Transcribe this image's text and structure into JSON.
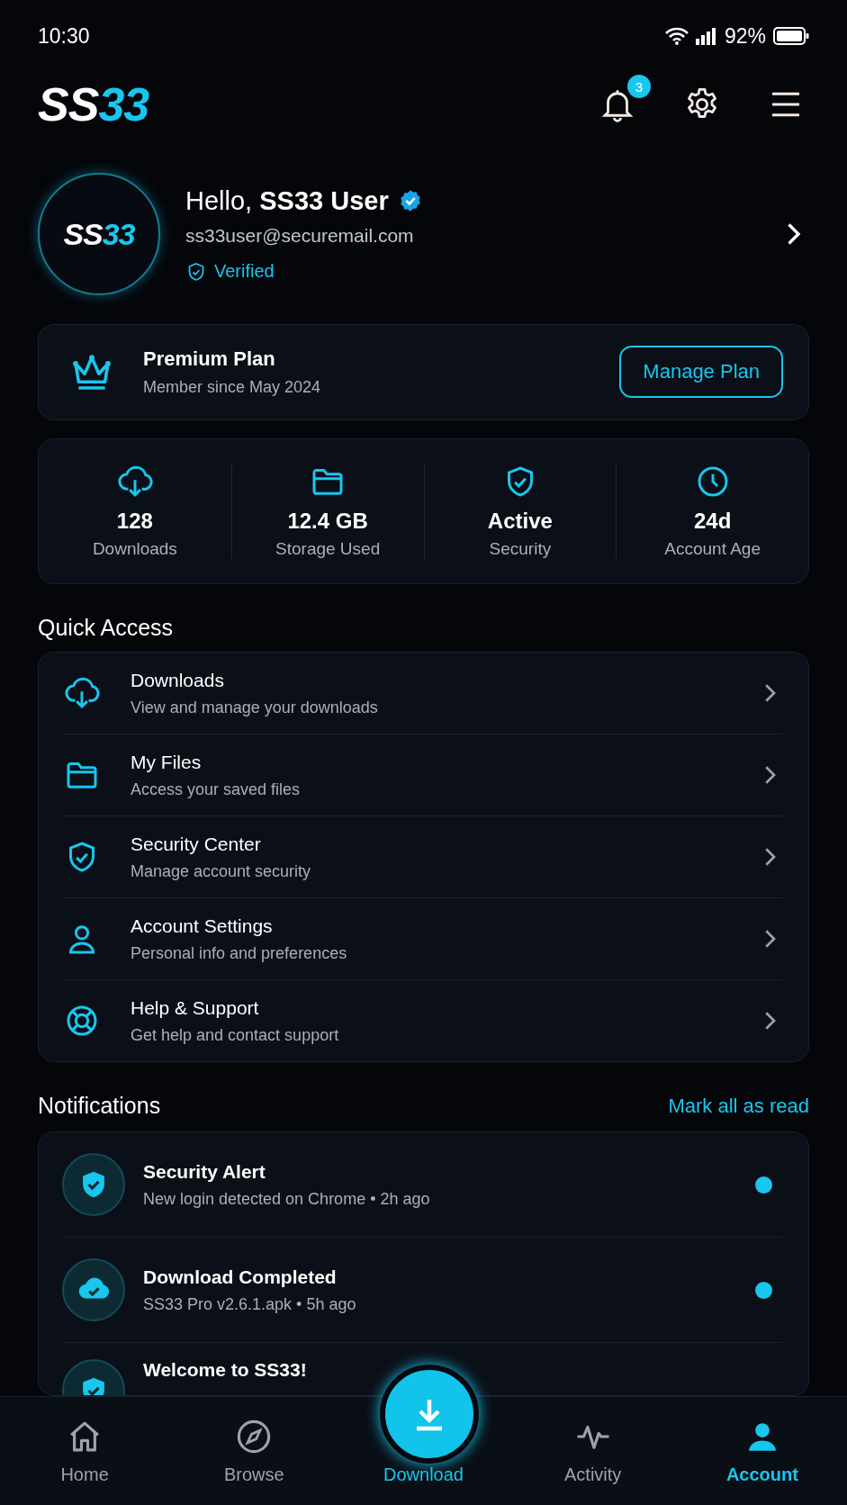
{
  "status_bar": {
    "time": "10:30",
    "battery": "92%"
  },
  "header": {
    "logo": [
      {
        "text": "SS",
        "color": "#ffffff"
      },
      {
        "text": "33",
        "color": "#19c6ee"
      }
    ],
    "notification_count": "3"
  },
  "profile": {
    "avatar_logo": [
      {
        "text": "SS",
        "color": "#ffffff"
      },
      {
        "text": "33",
        "color": "#19c6ee"
      }
    ],
    "greeting": "Hello, **SS33 User**",
    "verified_badge": true,
    "email": "ss33user@securemail.com",
    "status": "Verified"
  },
  "plan": {
    "title": "Premium Plan",
    "subtitle": "Member since May 2024",
    "button": "Manage Plan"
  },
  "stats": [
    {
      "kind": "cloud",
      "value": "128",
      "label": "Downloads"
    },
    {
      "kind": "folder",
      "value": "12.4 GB",
      "label": "Storage Used"
    },
    {
      "kind": "shield",
      "value": "Active",
      "label": "Security"
    },
    {
      "kind": "clock",
      "value": "24d",
      "label": "Account Age"
    }
  ],
  "quick_access": {
    "title": "Quick Access",
    "items": [
      {
        "kind": "cloud",
        "title": "Downloads",
        "subtitle": "View and manage your downloads"
      },
      {
        "kind": "folder",
        "title": "My Files",
        "subtitle": "Access your saved files"
      },
      {
        "kind": "shield",
        "title": "Security Center",
        "subtitle": "Manage account security"
      },
      {
        "kind": "person",
        "title": "Account Settings",
        "subtitle": "Personal info and preferences"
      },
      {
        "kind": "lifebuoy",
        "title": "Help & Support",
        "subtitle": "Get help and contact support"
      }
    ]
  },
  "notifications": {
    "title": "Notifications",
    "action": "Mark all as read",
    "items": [
      {
        "kind": "shield",
        "title": "Security Alert",
        "subtitle": "New login detected on Chrome • 2h ago",
        "unread": true
      },
      {
        "kind": "cloud",
        "title": "Download Completed",
        "subtitle": "SS33 Pro v2.6.1.apk • 5h ago",
        "unread": true
      },
      {
        "kind": "shield",
        "title": "Welcome to SS33!",
        "unread": false
      }
    ]
  },
  "nav": [
    {
      "kind": "home",
      "label": "Home",
      "selected": false
    },
    {
      "kind": "compass",
      "label": "Browse",
      "selected": false
    },
    {
      "kind": "download",
      "label": "Download",
      "selected": false
    },
    {
      "kind": "activity",
      "label": "Activity",
      "selected": false
    },
    {
      "kind": "person",
      "label": "Account",
      "selected": true
    }
  ]
}
